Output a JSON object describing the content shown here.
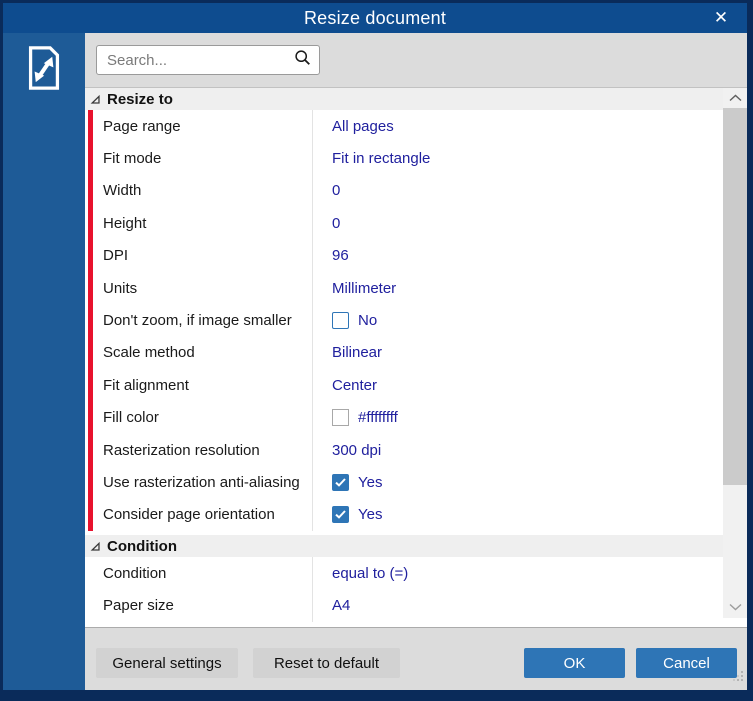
{
  "window": {
    "title": "Resize document"
  },
  "icons": {
    "close": "✕",
    "sidebar": "resize-document-icon",
    "search": "magnifier-icon"
  },
  "search": {
    "placeholder": "Search..."
  },
  "sections": [
    {
      "title": "Resize to",
      "rows": [
        {
          "label": "Page range",
          "value": "All pages",
          "control": "text",
          "marked": true
        },
        {
          "label": "Fit mode",
          "value": "Fit in rectangle",
          "control": "text",
          "marked": true
        },
        {
          "label": "Width",
          "value": "0",
          "control": "text",
          "marked": true
        },
        {
          "label": "Height",
          "value": "0",
          "control": "text",
          "marked": true
        },
        {
          "label": "DPI",
          "value": "96",
          "control": "text",
          "marked": true
        },
        {
          "label": "Units",
          "value": "Millimeter",
          "control": "text",
          "marked": true
        },
        {
          "label": "Don't zoom, if image smaller",
          "value": "No",
          "control": "checkbox",
          "checked": false,
          "marked": true
        },
        {
          "label": "Scale method",
          "value": "Bilinear",
          "control": "text",
          "marked": true
        },
        {
          "label": "Fit alignment",
          "value": "Center",
          "control": "text",
          "marked": true
        },
        {
          "label": "Fill color",
          "value": "#ffffffff",
          "control": "color",
          "swatch": "#ffffff",
          "marked": true
        },
        {
          "label": "Rasterization resolution",
          "value": "300 dpi",
          "control": "text",
          "marked": true
        },
        {
          "label": "Use rasterization anti-aliasing",
          "value": "Yes",
          "control": "checkbox",
          "checked": true,
          "marked": true
        },
        {
          "label": "Consider page orientation",
          "value": "Yes",
          "control": "checkbox",
          "checked": true,
          "marked": true
        }
      ]
    },
    {
      "title": "Condition",
      "rows": [
        {
          "label": "Condition",
          "value": "equal to (=)",
          "control": "text",
          "marked": false
        },
        {
          "label": "Paper size",
          "value": "A4",
          "control": "text",
          "marked": false
        }
      ]
    }
  ],
  "footer": {
    "general_settings": "General settings",
    "reset_to_default": "Reset to default",
    "ok": "OK",
    "cancel": "Cancel"
  },
  "colors": {
    "titlebar_blue": "#0e4c8f",
    "sidebar_blue": "#1e5b97",
    "window_border": "#0a2b5a",
    "accent_blue": "#2e75b6",
    "value_text_navy": "#20209e",
    "modified_marker_red": "#e8112d",
    "panel_gray": "#dcdcdc"
  }
}
